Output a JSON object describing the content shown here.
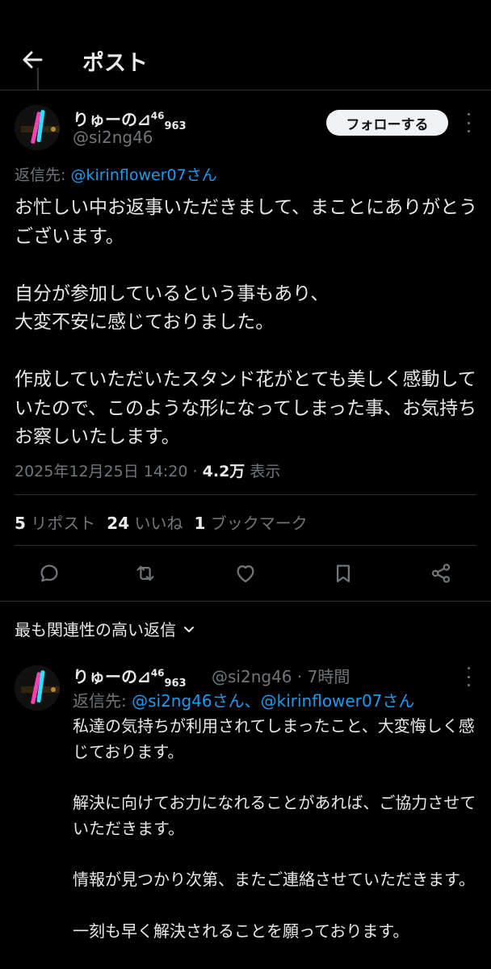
{
  "header": {
    "title": "ポスト"
  },
  "tweet": {
    "name": "りゅーの⊿",
    "name_sup": "46",
    "name_sub": "963",
    "handle": "@si2ng46",
    "follow_label": "フォローする",
    "replying_prefix": "返信先: ",
    "replying_to": "@kirinflower07さん",
    "text": "お忙しい中お返事いただきまして、まことにありがとうございます。\n\n自分が参加しているという事もあり、\n大変不安に感じておりました。\n\n作成していただいたスタンド花がとても美しく感動していたので、このような形になってしまった事、お気持ちお察しいたします。",
    "timestamp": "2025年12月25日 14:20 · ",
    "views_count": "4.2万",
    "views_label": " 表示",
    "reposts_count": "5",
    "reposts_label": " リポスト",
    "likes_count": "24",
    "likes_label": " いいね",
    "bookmarks_count": "1",
    "bookmarks_label": " ブックマーク"
  },
  "actions": [
    "reply-icon",
    "repost-icon",
    "like-icon",
    "bookmark-icon",
    "share-icon"
  ],
  "relevance_label": "最も関連性の高い返信",
  "reply": {
    "name": "りゅーの⊿",
    "name_sup": "46",
    "name_sub": "963",
    "handle_time": "@si2ng46 · 7時間",
    "replying_prefix": "返信先: ",
    "replying_to": "@si2ng46さん、@kirinflower07さん",
    "text": "私達の気持ちが利用されてしまったこと、大変悔しく感じております。\n\n解決に向けてお力になれることがあれば、ご協力させていただきます。\n\n情報が見つかり次第、またご連絡させていただきます。\n\n一刻も早く解決されることを願っております。"
  },
  "colors": {
    "background": "#000000",
    "text": "#e7e9ea",
    "muted": "#71767b",
    "link": "#1d9bf0",
    "border": "#2f3336"
  }
}
